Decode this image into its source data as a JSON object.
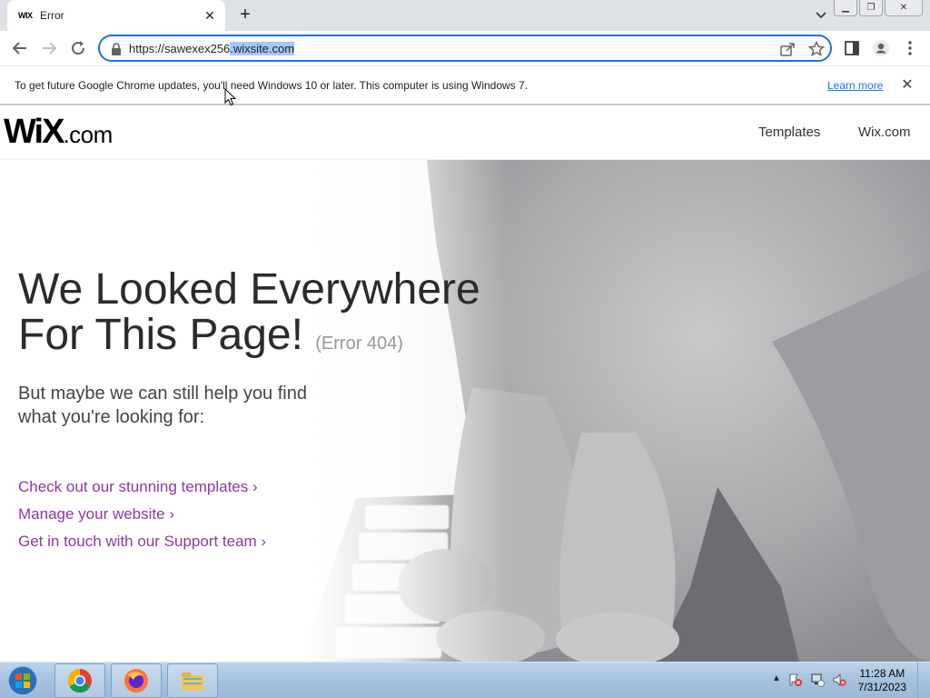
{
  "browser": {
    "tab": {
      "favicon_text": "WIX",
      "title": "Error"
    },
    "address": {
      "url_prefix": "https://sawexex256",
      "url_selected": ".wixsite.com"
    }
  },
  "infobar": {
    "message": "To get future Google Chrome updates, you'll need Windows 10 or later. This computer is using Windows 7.",
    "link": "Learn more"
  },
  "site": {
    "logo_main": "WiX",
    "logo_suffix": ".com",
    "nav": [
      "Templates",
      "Wix.com"
    ],
    "heading_line1": "We Looked Everywhere",
    "heading_line2": "For This Page!",
    "error_code": "(Error 404)",
    "sub_line1": "But maybe we can still help you find",
    "sub_line2": "what you're looking for:",
    "links": [
      "Check out our stunning templates ›",
      "Manage your website ›",
      "Get in touch with our Support team ›"
    ],
    "link_color": "#8c38a8"
  },
  "taskbar": {
    "time": "11:28 AM",
    "date": "7/31/2023",
    "apps": [
      "chrome-icon",
      "firefox-icon",
      "file-explorer-icon"
    ]
  }
}
